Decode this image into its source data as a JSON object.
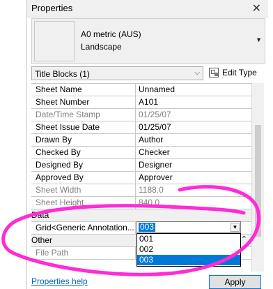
{
  "panel": {
    "title": "Properties"
  },
  "type_preview": {
    "line1": "A0 metric (AUS)",
    "line2": "Landscape"
  },
  "filter": {
    "value": "Title Blocks (1)"
  },
  "edit_type": {
    "label": "Edit Type"
  },
  "properties": [
    {
      "name": "Sheet Name",
      "value": "Unnamed",
      "dim": false
    },
    {
      "name": "Sheet Number",
      "value": "A101",
      "dim": false
    },
    {
      "name": "Date/Time Stamp",
      "value": "01/25/07",
      "dim": true
    },
    {
      "name": "Sheet Issue Date",
      "value": "01/25/07",
      "dim": false
    },
    {
      "name": "Drawn By",
      "value": "Author",
      "dim": false
    },
    {
      "name": "Checked By",
      "value": "Checker",
      "dim": false
    },
    {
      "name": "Designed By",
      "value": "Designer",
      "dim": false
    },
    {
      "name": "Approved By",
      "value": "Approver",
      "dim": false
    },
    {
      "name": "Sheet Width",
      "value": "1188.0",
      "dim": true
    },
    {
      "name": "Sheet Height",
      "value": "840.0",
      "dim": true
    }
  ],
  "data_group": {
    "label": "Data",
    "param_name": "Grid<Generic Annotation...",
    "selected": "003",
    "options": [
      "001",
      "002",
      "003"
    ]
  },
  "other_group": {
    "label": "Other",
    "toggle": "⌃",
    "items": [
      {
        "name": "File Path"
      }
    ]
  },
  "footer": {
    "help_link": "Properties help",
    "apply_label": "Apply"
  },
  "colors": {
    "selection": "#0078d7",
    "annotation": "#ff2bd6",
    "link": "#0066cc"
  }
}
